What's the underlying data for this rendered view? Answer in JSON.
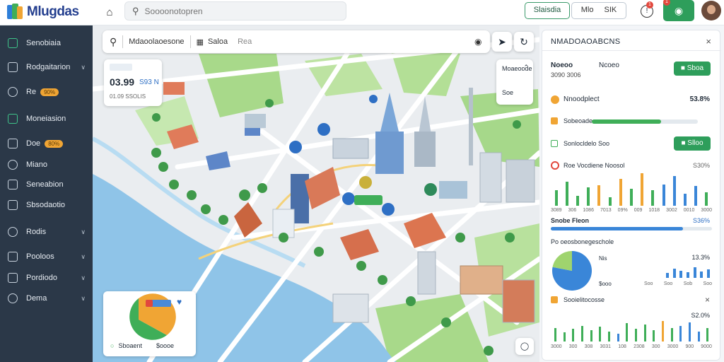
{
  "header": {
    "logo": "Mlugdas",
    "search_placeholder": "Soooonotopren",
    "btn_outline": "Slaisdia",
    "btn_right": "Mlo",
    "btn_right_extra": "SIK",
    "badge_count": "1",
    "greenbtn_badge": "1",
    "colors": {
      "brand": "#243f8f",
      "accent": "#2e9e5b",
      "alert": "#e2483d"
    }
  },
  "sidebar": {
    "items": [
      {
        "label": "Senobiaia",
        "icon": "table-icon",
        "active": true
      },
      {
        "label": "Rodgaitarion",
        "icon": "layers-icon",
        "chevron": true
      },
      {
        "label": "Re",
        "icon": "compass-icon",
        "pill": "90%"
      },
      {
        "label": "Moneiasion",
        "icon": "chat-icon",
        "active": true
      },
      {
        "label": "Doe",
        "icon": "globe-icon",
        "pill": "80%"
      },
      {
        "label": "Miano",
        "icon": "table-icon"
      },
      {
        "label": "Seneabion",
        "icon": "card-icon"
      },
      {
        "label": "Sbsodaotio",
        "icon": "pen-icon"
      },
      {
        "label": "Rodis",
        "icon": "toggle-icon",
        "chevron": true
      },
      {
        "label": "Pooloos",
        "icon": "cube-icon",
        "chevron": true
      },
      {
        "label": "Pordiodo",
        "icon": "gamepad-icon",
        "chevron": true
      },
      {
        "label": "Dema",
        "icon": "gear-icon",
        "chevron": true
      }
    ]
  },
  "map": {
    "search_text": "Mdaoolaoesone",
    "tab": "Saloa",
    "subtab": "Rea",
    "stats_card": {
      "value": "03.99",
      "value2": "S93 N",
      "sub": "01.09 SSOLIS"
    },
    "layers_card": {
      "title": "Moaeoode",
      "item": "Soe"
    },
    "legend_card": {
      "label": "Sboaent",
      "tag": "$oooe"
    }
  },
  "panel": {
    "title": "NMADOAOABCNS",
    "row1_label": "Noeoo",
    "row1_sub": "3090 3006",
    "row1_value": "Ncoeo",
    "row1_button": "Sboa",
    "metric1_label": "Nnoodplect",
    "metric1_value": "53.8%",
    "metric2_label": "Sobeoades",
    "metric2_fill": 0.65,
    "metric3_label": "Sonlocldelo Soo",
    "metric3_button": "Slloo",
    "metric4_label": "Roe Vocdiene Noosol",
    "metric4_value": "S30%",
    "bars1": [
      0.45,
      0.7,
      0.3,
      0.55,
      0.6,
      0.25,
      0.8,
      0.5,
      0.95,
      0.45,
      0.62,
      0.88,
      0.35,
      0.58,
      0.4
    ],
    "bars1_colors": [
      "#3fae58",
      "#3fae58",
      "#3fae58",
      "#3fae58",
      "#f0a534",
      "#3fae58",
      "#f0a534",
      "#3fae58",
      "#f0a534",
      "#3fae58",
      "#3a86d8",
      "#3a86d8",
      "#3a86d8",
      "#3a86d8",
      "#3fae58"
    ],
    "bars1_xlabels": [
      "3089",
      "306",
      "1086",
      "7013",
      "09%",
      "009",
      "1018",
      "3002",
      "0010",
      "3000"
    ],
    "metric5_label": "Snobe Fleon",
    "metric5_value": "S36%",
    "metric5_fill": 0.82,
    "metric6_label": "Po oeosbonegeschole",
    "pie": {
      "slices": [
        0.78,
        0.22
      ],
      "colors": [
        "#3a86d8",
        "#9fd46e"
      ],
      "label": "Nis",
      "sub": "$ooo"
    },
    "metric6_value": "13.3%",
    "bars2": [
      0.3,
      0.6,
      0.45,
      0.35,
      0.7,
      0.4,
      0.55
    ],
    "bars2_xlabels": [
      "Soo",
      "Soo",
      "Sob",
      "Soo"
    ],
    "metric7_label": "Sooielitocosse",
    "metric7_value": "S2.0%",
    "bars3": [
      0.6,
      0.4,
      0.55,
      0.7,
      0.5,
      0.65,
      0.45,
      0.35,
      0.8,
      0.55,
      0.75,
      0.5,
      0.9,
      0.6,
      0.7,
      0.85,
      0.45,
      0.6
    ],
    "bars3_colors": [
      "#3fae58",
      "#3fae58",
      "#3fae58",
      "#3fae58",
      "#3fae58",
      "#3fae58",
      "#3fae58",
      "#3a86d8",
      "#3fae58",
      "#3fae58",
      "#3fae58",
      "#3fae58",
      "#f0a534",
      "#3fae58",
      "#3a86d8",
      "#3a86d8",
      "#3a86d8",
      "#3fae58"
    ],
    "bars3_xlabels": [
      "3000",
      "300",
      "308",
      "3031",
      "108",
      "2308",
      "300",
      "3000",
      "900",
      "9000"
    ]
  }
}
